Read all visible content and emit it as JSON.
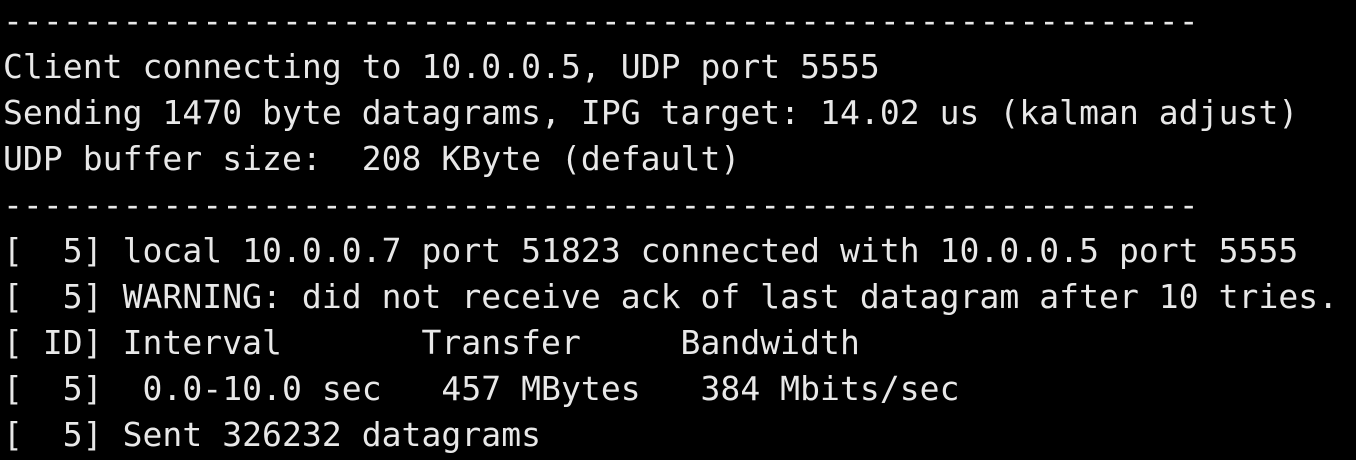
{
  "terminal": {
    "text_color": "#e8e8e8",
    "background_color": "#000000",
    "lines": [
      "------------------------------------------------------------",
      "Client connecting to 10.0.0.5, UDP port 5555",
      "Sending 1470 byte datagrams, IPG target: 14.02 us (kalman adjust)",
      "UDP buffer size:  208 KByte (default)",
      "------------------------------------------------------------",
      "[  5] local 10.0.0.7 port 51823 connected with 10.0.0.5 port 5555",
      "[  5] WARNING: did not receive ack of last datagram after 10 tries.",
      "[ ID] Interval       Transfer     Bandwidth",
      "[  5]  0.0-10.0 sec   457 MBytes   384 Mbits/sec",
      "[  5] Sent 326232 datagrams"
    ]
  }
}
